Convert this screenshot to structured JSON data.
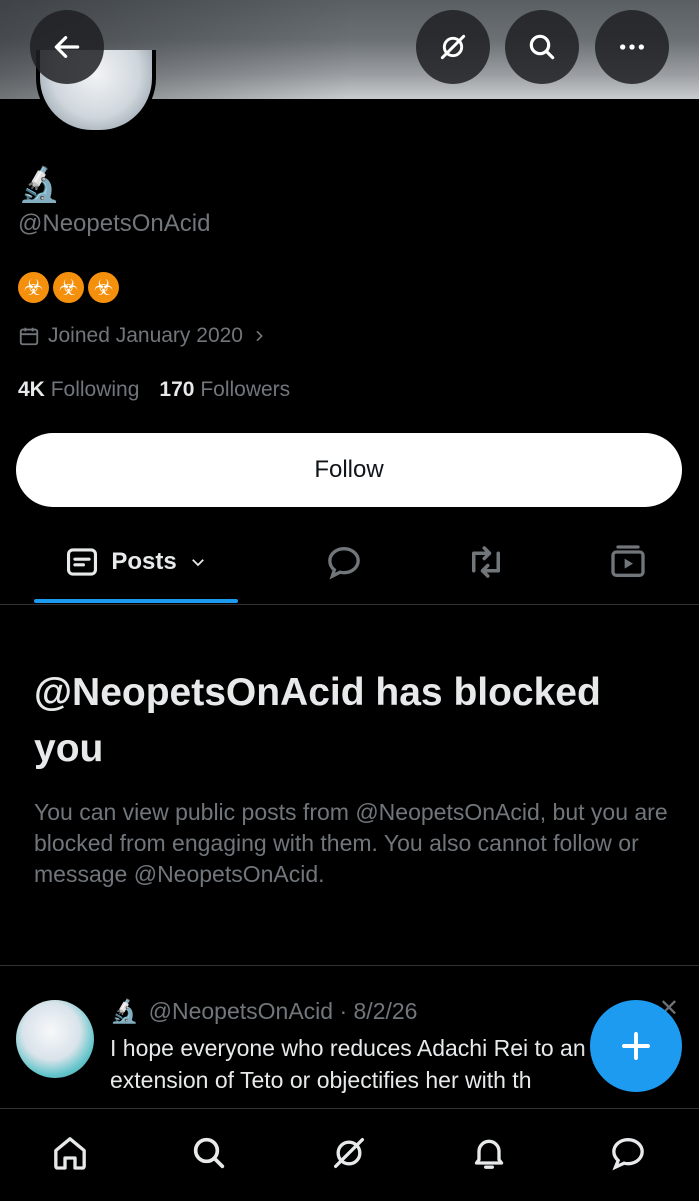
{
  "profile": {
    "name_emoji": "🔬",
    "handle": "@NeopetsOnAcid",
    "badges": [
      "☣",
      "☣",
      "☣"
    ],
    "joined": "Joined January 2020",
    "following_count": "4K",
    "following_label": "Following",
    "followers_count": "170",
    "followers_label": "Followers"
  },
  "actions": {
    "follow_label": "Follow"
  },
  "tabs": {
    "posts_label": "Posts"
  },
  "blocked": {
    "title": "@NeopetsOnAcid has blocked you",
    "message": "You can view public posts from @NeopetsOnAcid, but you are blocked from engaging with them. You also cannot follow or message @NeopetsOnAcid."
  },
  "post": {
    "emoji": "🔬",
    "handle_date": "@NeopetsOnAcid · 8/2/26",
    "text": "I hope everyone who reduces Adachi Rei to an extension of Teto or objectifies her with th"
  },
  "colors": {
    "accent": "#1d9bf0",
    "background": "#000000",
    "muted": "#71767b"
  }
}
